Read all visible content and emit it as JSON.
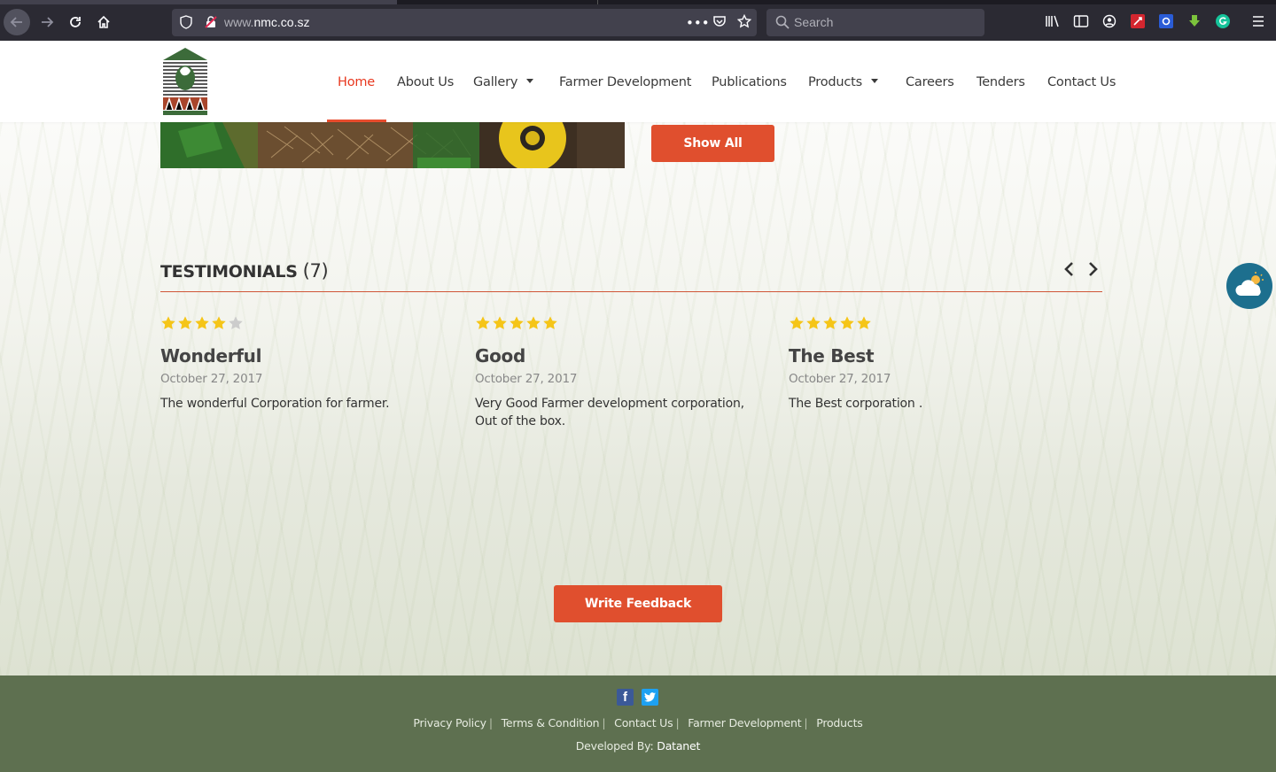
{
  "browser": {
    "url_prefix": "www.",
    "url_domain": "nmc.co.sz",
    "search_placeholder": "Search"
  },
  "nav": {
    "items": [
      "Home",
      "About Us",
      "Gallery",
      "Farmer Development",
      "Publications",
      "Products",
      "Careers",
      "Tenders",
      "Contact Us"
    ],
    "active": "Home"
  },
  "gallery": {
    "show_all": "Show All"
  },
  "testimonials": {
    "title": "TESTIMONIALS",
    "count": "(7)",
    "cards": [
      {
        "rating": 4,
        "title": "Wonderful",
        "date": "October 27, 2017",
        "body": "The wonderful Corporation for farmer."
      },
      {
        "rating": 5,
        "title": "Good",
        "date": "October 27, 2017",
        "body": "Very Good Farmer development corporation, Out of the box."
      },
      {
        "rating": 5,
        "title": "The Best",
        "date": "October 27, 2017",
        "body": "The Best corporation ."
      }
    ],
    "write_feedback": "Write Feedback"
  },
  "footer": {
    "links": [
      "Privacy Policy",
      "Terms & Condition",
      "Contact Us",
      "Farmer Development",
      "Products"
    ],
    "developed_by_label": "Developed By:",
    "developer": "Datanet"
  },
  "colors": {
    "accent": "#e04f2e",
    "nav_active": "#e8381f",
    "footer_bg": "#5e7050",
    "star_filled": "#f5c518",
    "star_empty": "#cccccc"
  }
}
